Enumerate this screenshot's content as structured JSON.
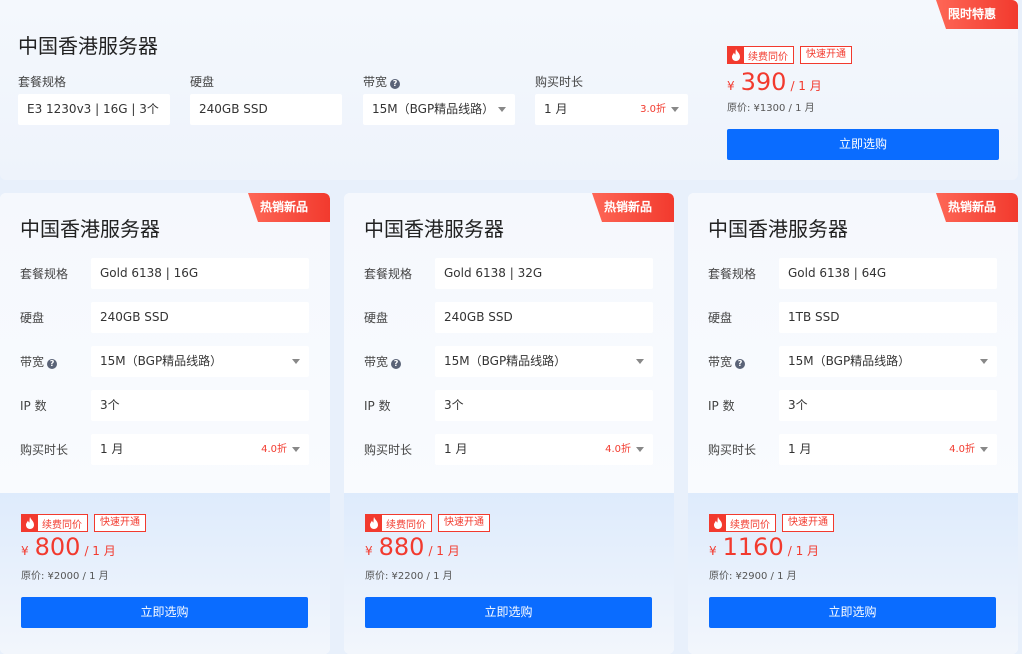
{
  "colors": {
    "accent": "#0a6cff",
    "price": "#f23a2e"
  },
  "top": {
    "ribbon": "限时特惠",
    "title": "中国香港服务器",
    "fields": {
      "spec_label": "套餐规格",
      "spec_value": "E3 1230v3 | 16G | 3个",
      "disk_label": "硬盘",
      "disk_value": "240GB SSD",
      "bw_label": "带宽",
      "bw_value": "15M（BGP精品线路）",
      "dur_label": "购买时长",
      "dur_value": "1 月",
      "dur_discount": "3.0折"
    },
    "badge_renew": "续费同价",
    "badge_fast": "快速开通",
    "price_symbol": "¥",
    "price": "390",
    "price_unit": "/ 1 月",
    "original": "原价: ¥1300 / 1 月",
    "buy": "立即选购"
  },
  "cards": [
    {
      "ribbon": "热销新品",
      "title": "中国香港服务器",
      "spec_label": "套餐规格",
      "spec_value": "Gold 6138 | 16G",
      "disk_label": "硬盘",
      "disk_value": "240GB SSD",
      "bw_label": "带宽",
      "bw_value": "15M（BGP精品线路）",
      "ip_label": "IP 数",
      "ip_value": "3个",
      "dur_label": "购买时长",
      "dur_value": "1 月",
      "dur_discount": "4.0折",
      "badge_renew": "续费同价",
      "badge_fast": "快速开通",
      "price_symbol": "¥",
      "price": "800",
      "price_unit": "/ 1 月",
      "original": "原价: ¥2000 / 1 月",
      "buy": "立即选购"
    },
    {
      "ribbon": "热销新品",
      "title": "中国香港服务器",
      "spec_label": "套餐规格",
      "spec_value": "Gold 6138 | 32G",
      "disk_label": "硬盘",
      "disk_value": "240GB SSD",
      "bw_label": "带宽",
      "bw_value": "15M（BGP精品线路）",
      "ip_label": "IP 数",
      "ip_value": "3个",
      "dur_label": "购买时长",
      "dur_value": "1 月",
      "dur_discount": "4.0折",
      "badge_renew": "续费同价",
      "badge_fast": "快速开通",
      "price_symbol": "¥",
      "price": "880",
      "price_unit": "/ 1 月",
      "original": "原价: ¥2200 / 1 月",
      "buy": "立即选购"
    },
    {
      "ribbon": "热销新品",
      "title": "中国香港服务器",
      "spec_label": "套餐规格",
      "spec_value": "Gold 6138 | 64G",
      "disk_label": "硬盘",
      "disk_value": "1TB SSD",
      "bw_label": "带宽",
      "bw_value": "15M（BGP精品线路）",
      "ip_label": "IP 数",
      "ip_value": "3个",
      "dur_label": "购买时长",
      "dur_value": "1 月",
      "dur_discount": "4.0折",
      "badge_renew": "续费同价",
      "badge_fast": "快速开通",
      "price_symbol": "¥",
      "price": "1160",
      "price_unit": "/ 1 月",
      "original": "原价: ¥2900 / 1 月",
      "buy": "立即选购"
    }
  ]
}
